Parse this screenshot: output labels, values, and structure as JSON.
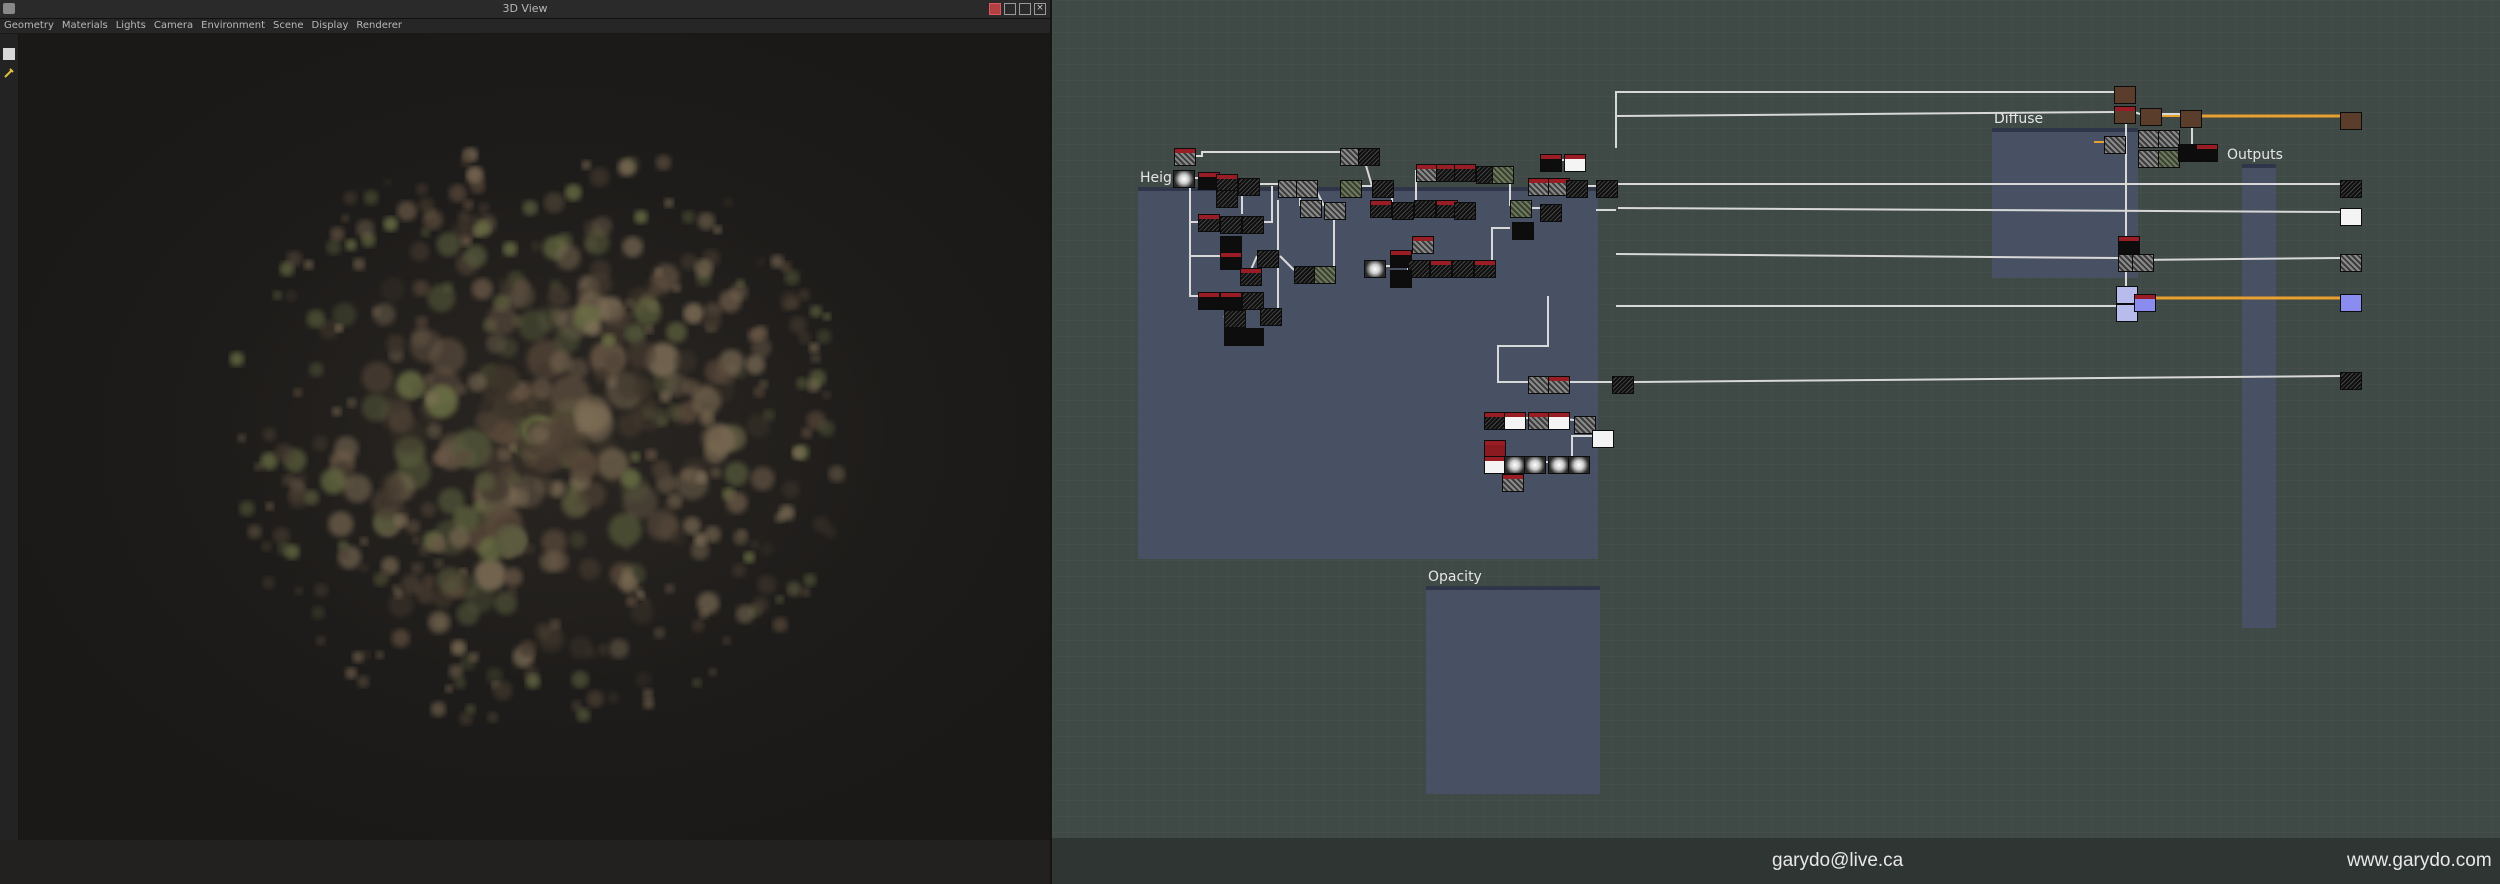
{
  "view3d": {
    "title": "3D View",
    "menu": [
      "Geometry",
      "Materials",
      "Lights",
      "Camera",
      "Environment",
      "Scene",
      "Display",
      "Renderer"
    ],
    "window_buttons": [
      "pin-icon",
      "restore-icon",
      "maximize-icon",
      "close-icon"
    ]
  },
  "graph": {
    "frames": {
      "height": "Height",
      "diffuse": "Diffuse",
      "opacity": "Opacity",
      "outputs": "Outputs"
    },
    "colors": {
      "background": "#3f4945",
      "frame": "#4a5269",
      "wire": "#d8d8d8",
      "wire_highlight": "#e8a030",
      "node_header": "#9a1c24"
    }
  },
  "footer": {
    "email": "garydo@live.ca",
    "website": "www.garydo.com"
  }
}
